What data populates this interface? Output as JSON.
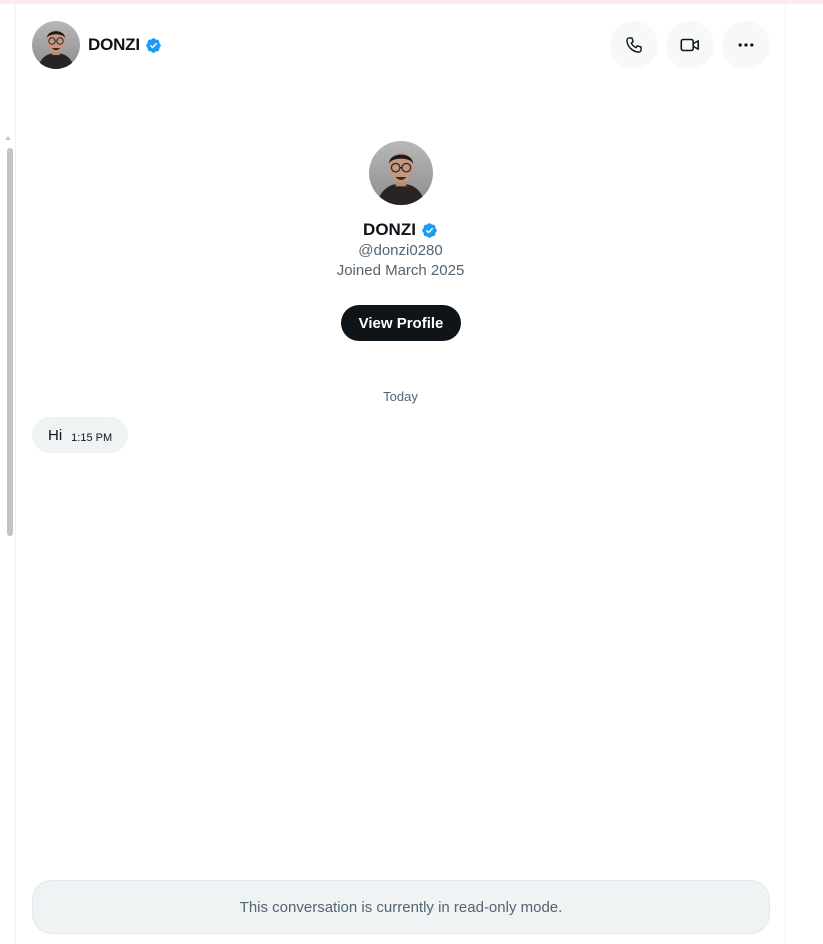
{
  "header": {
    "name": "DONZI",
    "avatar_icon": "user-avatar-photo",
    "actions": [
      {
        "name": "phone-call-button",
        "icon": "phone-icon"
      },
      {
        "name": "video-call-button",
        "icon": "video-icon"
      },
      {
        "name": "more-options-button",
        "icon": "more-horizontal-icon"
      }
    ]
  },
  "profile": {
    "name": "DONZI",
    "handle": "@donzi0280",
    "joined": "Joined March 2025",
    "button_label": "View Profile",
    "verified_color": "#1d9bf0"
  },
  "conversation": {
    "day_label": "Today",
    "messages": [
      {
        "text": "Hi",
        "time": "1:15 PM"
      }
    ]
  },
  "footer": {
    "readonly_text": "This conversation is currently in read-only mode."
  },
  "colors": {
    "primary_text": "#0f1419",
    "secondary_text": "#536471",
    "button_bg": "#0f1419",
    "bubble_bg": "#eff3f4",
    "verified_badge": "#1d9bf0"
  }
}
